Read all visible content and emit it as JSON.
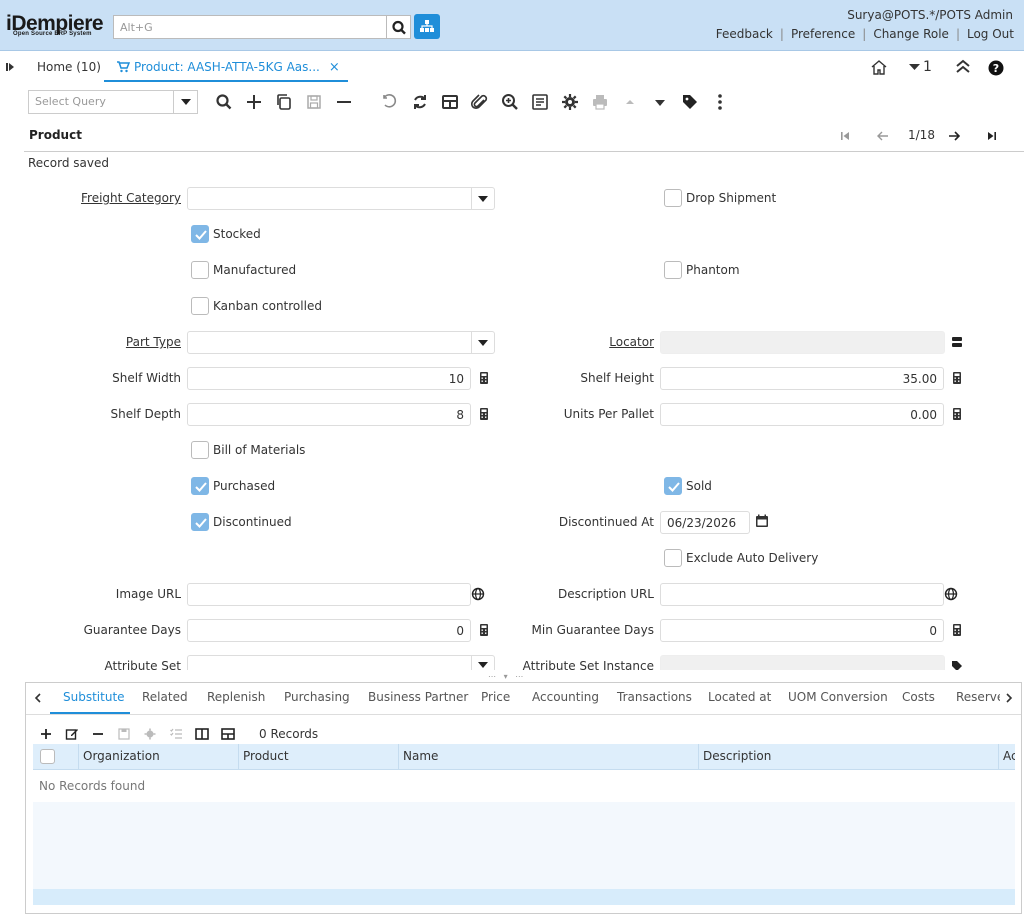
{
  "header": {
    "logo": "iDempiere",
    "logo_tagline": "Open Source ERP System",
    "search_placeholder": "Alt+G",
    "user": "Surya@POTS.*/POTS Admin",
    "links": [
      "Feedback",
      "Preference",
      "Change Role",
      "Log Out"
    ]
  },
  "tabs": {
    "home": "Home (10)",
    "active": "Product: AASH-ATTA-5KG Aas...",
    "close": "×",
    "count_badge": "1"
  },
  "toolbar": {
    "query_placeholder": "Select Query"
  },
  "window": {
    "title": "Product",
    "nav": "1/18",
    "status": "Record saved"
  },
  "form": {
    "freight_category": {
      "label": "Freight Category",
      "value": ""
    },
    "drop_shipment": {
      "label": "Drop Shipment",
      "checked": false
    },
    "stocked": {
      "label": "Stocked",
      "checked": true
    },
    "manufactured": {
      "label": "Manufactured",
      "checked": false
    },
    "phantom": {
      "label": "Phantom",
      "checked": false
    },
    "kanban": {
      "label": "Kanban controlled",
      "checked": false
    },
    "part_type": {
      "label": "Part Type",
      "value": ""
    },
    "locator": {
      "label": "Locator",
      "value": ""
    },
    "shelf_width": {
      "label": "Shelf Width",
      "value": "10"
    },
    "shelf_height": {
      "label": "Shelf Height",
      "value": "35.00"
    },
    "shelf_depth": {
      "label": "Shelf Depth",
      "value": "8"
    },
    "units_per_pallet": {
      "label": "Units Per Pallet",
      "value": "0.00"
    },
    "bom": {
      "label": "Bill of Materials",
      "checked": false
    },
    "purchased": {
      "label": "Purchased",
      "checked": true
    },
    "sold": {
      "label": "Sold",
      "checked": true
    },
    "discontinued": {
      "label": "Discontinued",
      "checked": true
    },
    "discontinued_at": {
      "label": "Discontinued At",
      "value": "06/23/2026"
    },
    "exclude_auto_delivery": {
      "label": "Exclude Auto Delivery",
      "checked": false
    },
    "image_url": {
      "label": "Image URL",
      "value": ""
    },
    "description_url": {
      "label": "Description URL",
      "value": ""
    },
    "guarantee_days": {
      "label": "Guarantee Days",
      "value": "0"
    },
    "min_guarantee_days": {
      "label": "Min Guarantee Days",
      "value": "0"
    },
    "attribute_set": {
      "label": "Attribute Set",
      "value": ""
    },
    "attribute_set_instance": {
      "label": "Attribute Set Instance",
      "value": ""
    }
  },
  "detail": {
    "tabs": [
      "Substitute",
      "Related",
      "Replenish",
      "Purchasing",
      "Business Partner",
      "Price",
      "Accounting",
      "Transactions",
      "Located at",
      "UOM Conversion",
      "Costs",
      "Reserved"
    ],
    "records": "0 Records",
    "columns": [
      "Organization",
      "Product",
      "Name",
      "Description",
      "Ac"
    ],
    "empty": "No Records found"
  },
  "colors": {
    "accent": "#1f8ed9",
    "header_bg": "#c9e0f5",
    "checkbox_on": "#7fb7e6"
  }
}
